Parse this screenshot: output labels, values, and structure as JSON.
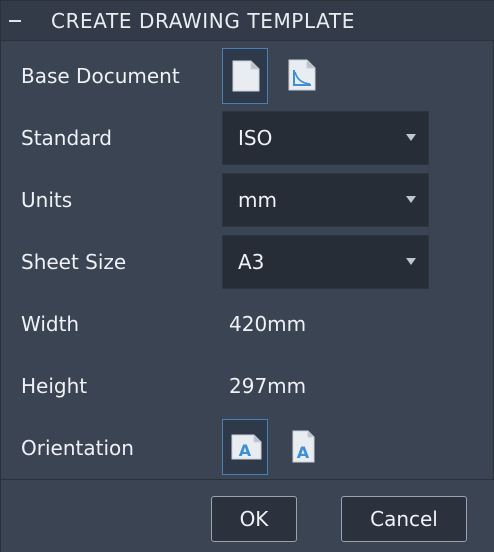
{
  "dialog": {
    "title": "CREATE DRAWING TEMPLATE"
  },
  "fields": {
    "base_document": {
      "label": "Base Document"
    },
    "standard": {
      "label": "Standard",
      "value": "ISO"
    },
    "units": {
      "label": "Units",
      "value": "mm"
    },
    "sheet_size": {
      "label": "Sheet Size",
      "value": "A3"
    },
    "width": {
      "label": "Width",
      "value": "420mm"
    },
    "height": {
      "label": "Height",
      "value": "297mm"
    },
    "orientation": {
      "label": "Orientation",
      "icon_letter": "A"
    }
  },
  "buttons": {
    "ok": "OK",
    "cancel": "Cancel"
  },
  "colors": {
    "accent": "#4a7fb3",
    "icon_blue": "#3d8fd6",
    "background": "#3b4452",
    "input_bg": "#262d37"
  }
}
